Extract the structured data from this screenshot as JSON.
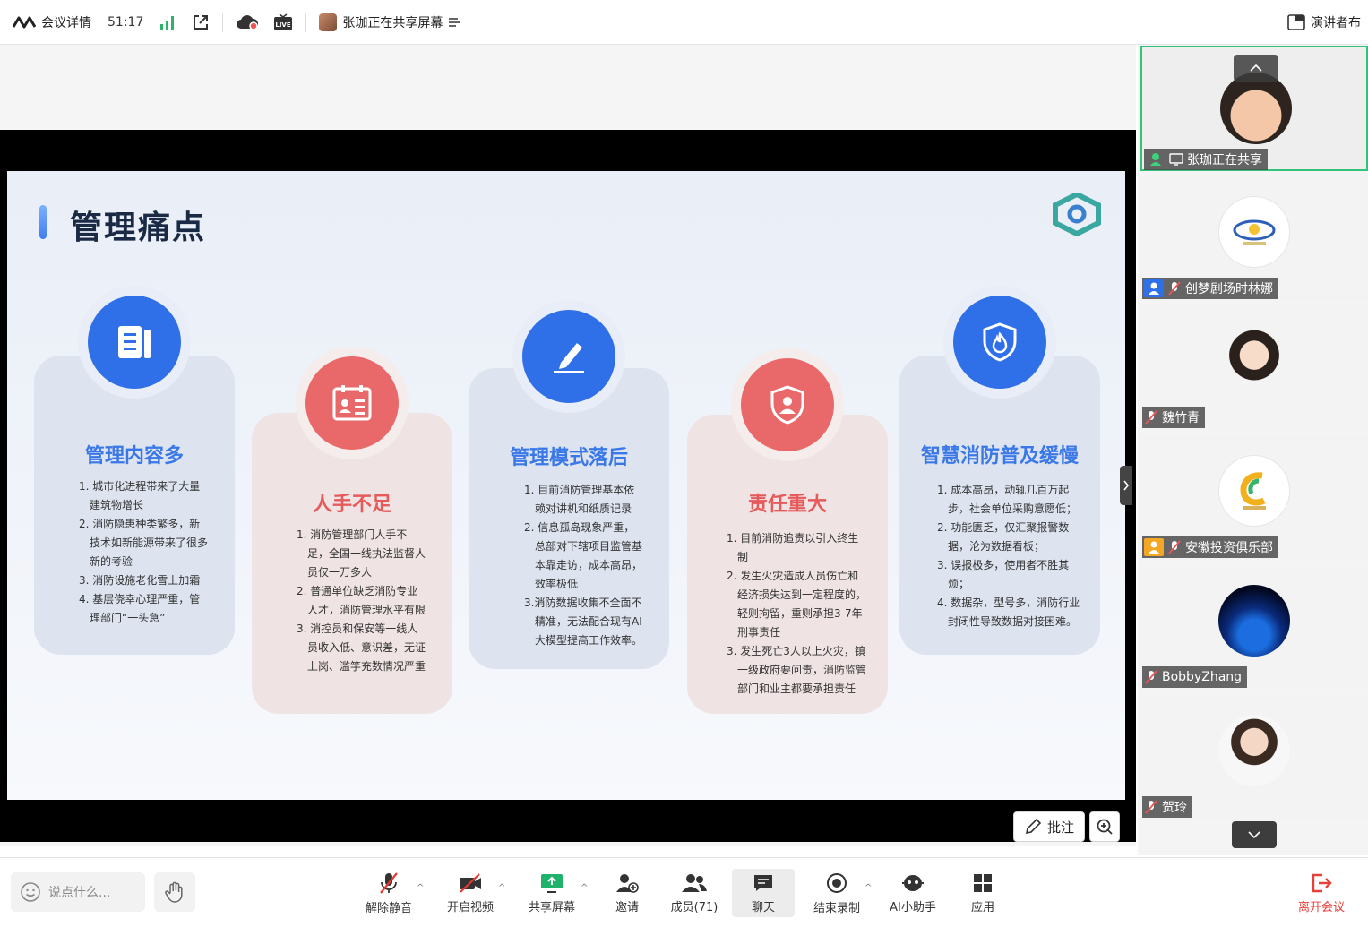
{
  "topbar": {
    "meeting_info": "会议详情",
    "timer": "51:17",
    "sharing_status": "张珈正在共享屏幕",
    "presenter_layout": "演讲者布"
  },
  "slide": {
    "title": "管理痛点",
    "cards": [
      {
        "title": "管理内容多",
        "items": [
          "1. 城市化进程带来了大量建筑物增长",
          "2. 消防隐患种类繁多，新技术如新能源带来了很多新的考验",
          "3. 消防设施老化雪上加霜",
          "4. 基层侥幸心理严重，管理部门“一头急”"
        ]
      },
      {
        "title": "人手不足",
        "items": [
          "1. 消防管理部门人手不足，全国一线执法监督人员仅一万多人",
          "2. 普通单位缺乏消防专业人才，消防管理水平有限",
          "3. 消控员和保安等一线人员收入低、意识差，无证上岗、滥竽充数情况严重"
        ]
      },
      {
        "title": "管理模式落后",
        "items": [
          "1. 目前消防管理基本依赖对讲机和纸质记录",
          "2. 信息孤岛现象严重，总部对下辖项目监管基本靠走访，成本高昂，效率极低",
          "3.消防数据收集不全面不精准，无法配合现有AI大模型提高工作效率。"
        ]
      },
      {
        "title": "责任重大",
        "items": [
          "1. 目前消防追责以引入终生制",
          "2. 发生火灾造成人员伤亡和经济损失达到一定程度的，轻则拘留，重则承担3-7年刑事责任",
          "3. 发生死亡3人以上火灾，镇一级政府要问责，消防监管部门和业主都要承担责任"
        ]
      },
      {
        "title": "智慧消防普及缓慢",
        "items": [
          "1. 成本高昂，动辄几百万起步，社会单位采购意愿低；",
          "2. 功能匮乏，仅汇聚报警数据，沦为数据看板；",
          "3. 误报极多，使用者不胜其烦；",
          "4. 数据杂，型号多，消防行业封闭性导致数据对接困难。"
        ]
      }
    ]
  },
  "share_tools": {
    "annotate": "批注"
  },
  "participants": [
    {
      "name": "张珈正在共享",
      "role": "host"
    },
    {
      "name": "创梦剧场时林娜",
      "role": "cohost"
    },
    {
      "name": "魏竹青",
      "role": ""
    },
    {
      "name": "安徽投资俱乐部",
      "role": "cohost-orange"
    },
    {
      "name": "BobbyZhang",
      "role": ""
    },
    {
      "name": "贺玲",
      "role": ""
    }
  ],
  "bottombar": {
    "chat_placeholder": "说点什么...",
    "buttons": {
      "unmute": "解除静音",
      "video": "开启视频",
      "share": "共享屏幕",
      "invite": "邀请",
      "members": "成员(71)",
      "chat": "聊天",
      "record": "结束录制",
      "ai": "AI小助手",
      "apps": "应用",
      "leave": "离开会议"
    }
  },
  "colors": {
    "accent_blue": "#2f6fe8",
    "accent_red": "#e9696a",
    "active_green": "#32c27a",
    "leave_red": "#e5413a"
  }
}
